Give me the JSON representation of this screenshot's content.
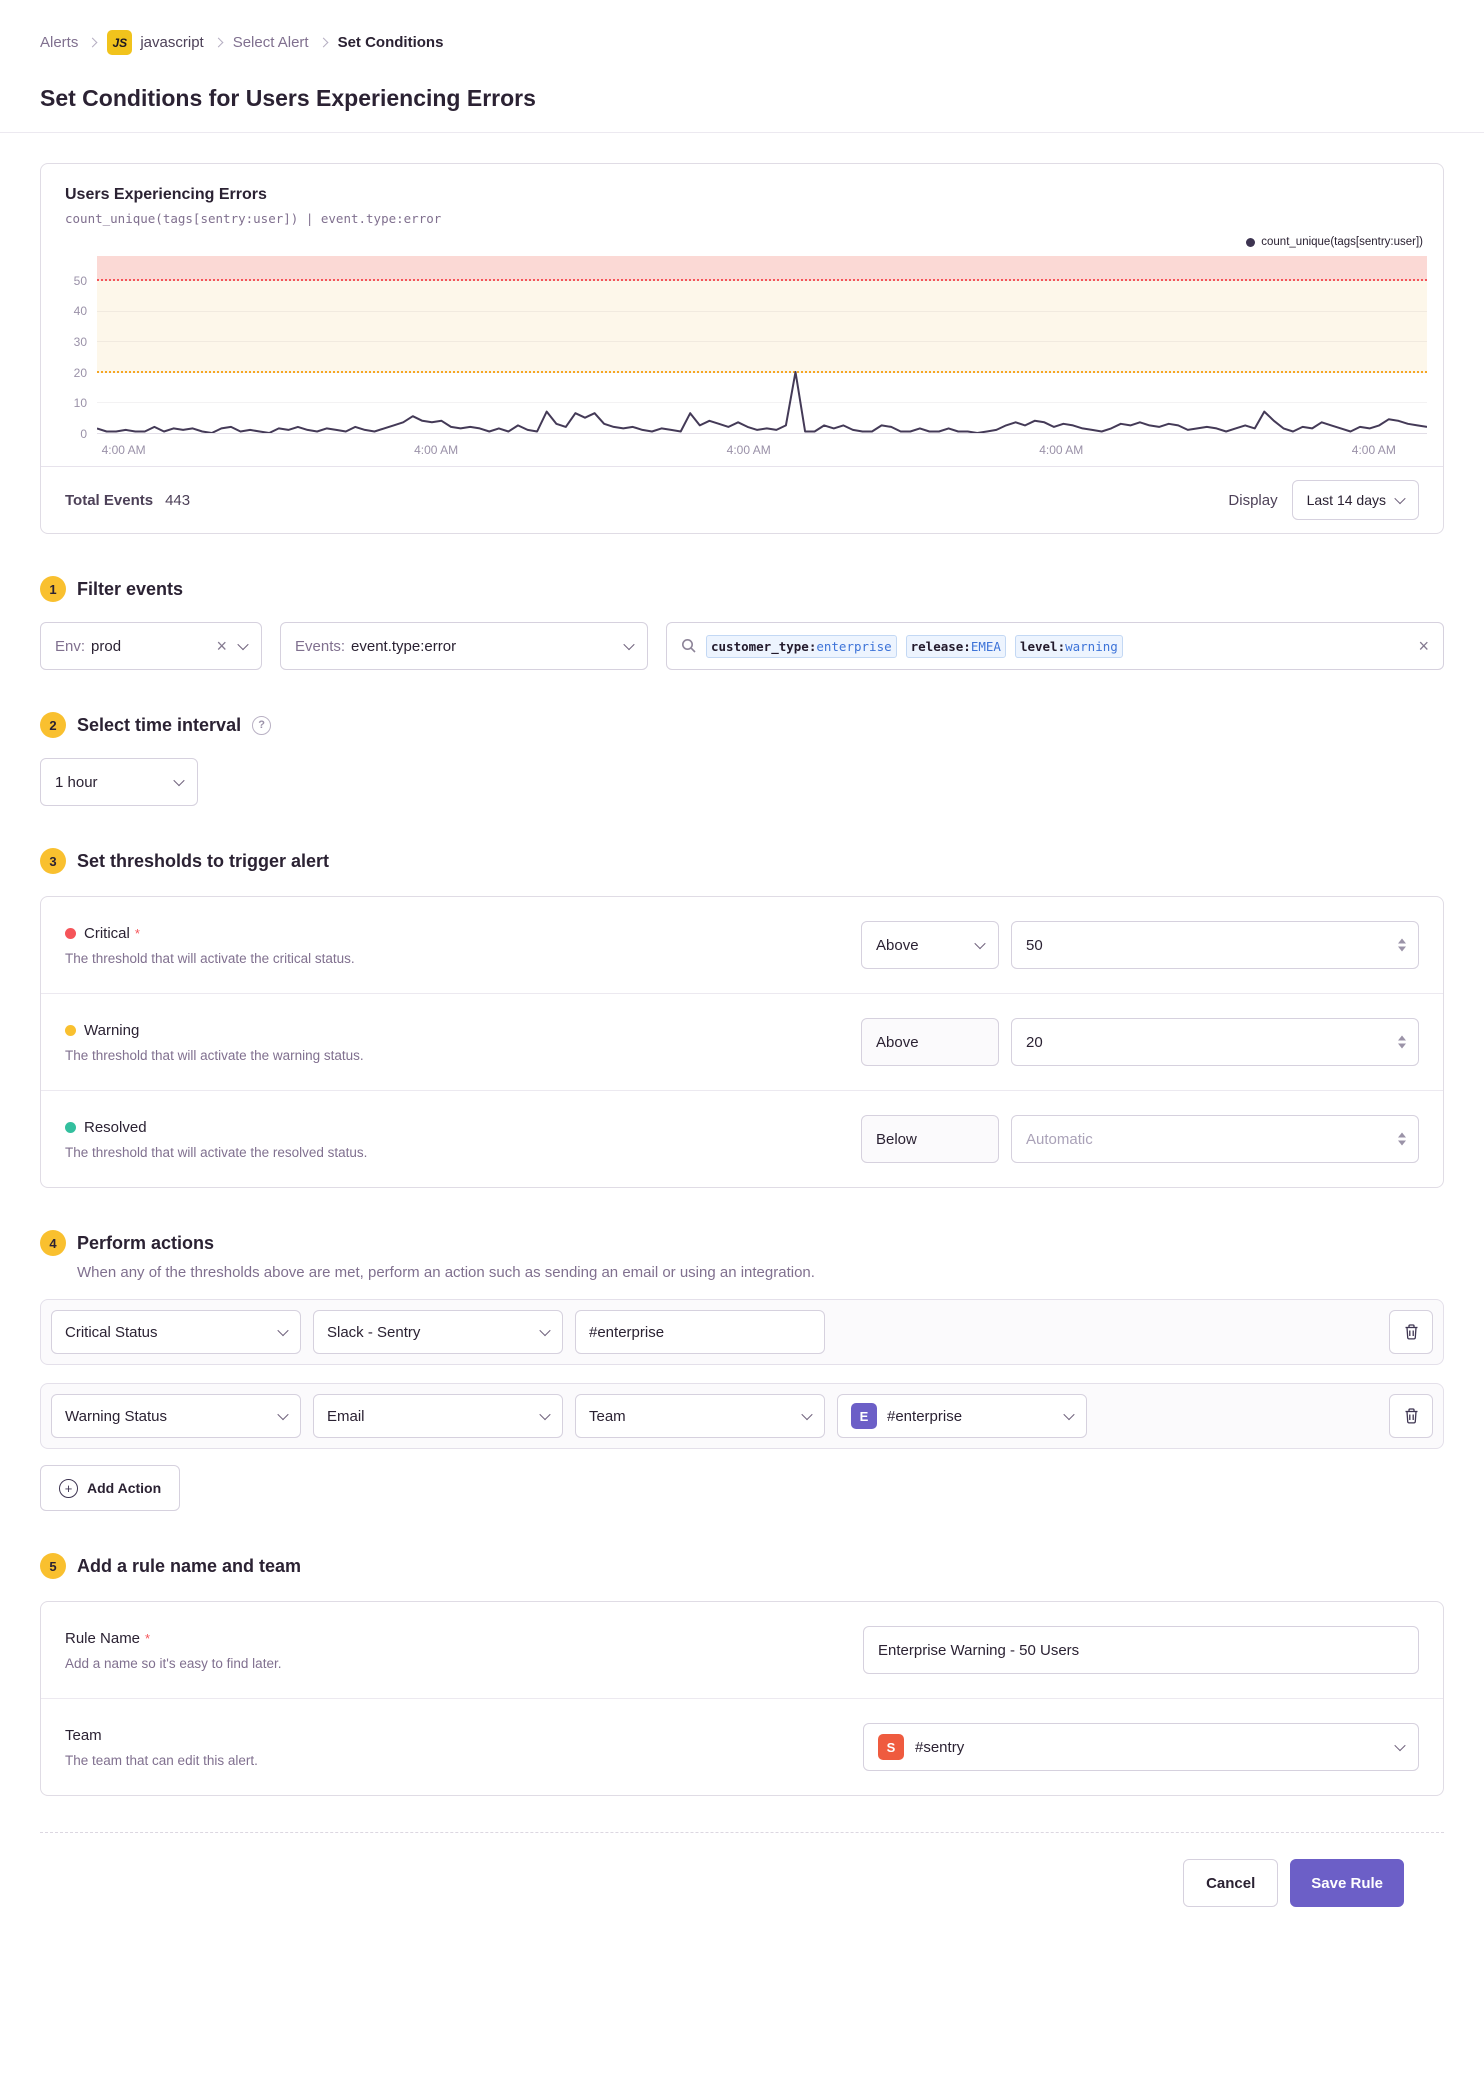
{
  "breadcrumb": {
    "items": [
      "Alerts",
      "javascript",
      "Select Alert",
      "Set Conditions"
    ],
    "project_badge": "JS"
  },
  "page": {
    "title": "Set Conditions for Users Experiencing Errors"
  },
  "icons": {
    "clear": "×",
    "plus": "+",
    "help": "?"
  },
  "misc": {
    "required_mark": "*"
  },
  "colors": {
    "accent": "#6c5fc7",
    "critical": "#f55459",
    "warning": "#f9c02f",
    "resolved": "#33bf9e",
    "badge": "#f9c02f",
    "token_value": "#3d73d8",
    "chart_line": "#443a57"
  },
  "chart_data": {
    "type": "line",
    "title": "Users Experiencing Errors",
    "query": "count_unique(tags[sentry:user]) | event.type:error",
    "legend": [
      "count_unique(tags[sentry:user])"
    ],
    "legend_position": "top-right",
    "grid": true,
    "x_tick_labels": [
      "4:00 AM",
      "4:00 AM",
      "4:00 AM",
      "4:00 AM",
      "4:00 AM"
    ],
    "y_ticks": [
      0,
      10,
      20,
      30,
      40,
      50
    ],
    "ylim": [
      0,
      58
    ],
    "thresholds": {
      "critical": 50,
      "warning": 20
    },
    "threshold_colors": {
      "critical": "#f55459",
      "warning": "#f5a623"
    },
    "band_colors": {
      "critical": "#fbd9d5",
      "warning": "#fdf7ea"
    },
    "line_color": "#443a57",
    "series": [
      {
        "name": "count_unique(tags[sentry:user])",
        "values": [
          1.5,
          0.5,
          0.5,
          1,
          0.5,
          0.5,
          2,
          0.5,
          1.5,
          1,
          1.5,
          0.5,
          0,
          1.5,
          2,
          0.5,
          1,
          0.5,
          0,
          1.5,
          1,
          2,
          1,
          0.5,
          1.5,
          1,
          0.5,
          2,
          1,
          0.5,
          1.5,
          2.5,
          3.5,
          5.5,
          4,
          3.5,
          4,
          2,
          1.5,
          2,
          1.5,
          0.5,
          1.5,
          0.5,
          2.5,
          1,
          0.5,
          7,
          3,
          2,
          6.5,
          5,
          6.5,
          3,
          2,
          1.5,
          2,
          1,
          0.5,
          1.5,
          1,
          0.5,
          6.5,
          2.5,
          4,
          3,
          2,
          3.5,
          2,
          1,
          1.5,
          1,
          2.5,
          20,
          0.5,
          0.5,
          2.5,
          1.5,
          2.5,
          1,
          0.5,
          0.5,
          2.5,
          2,
          0.5,
          0.5,
          1.5,
          0.5,
          0.5,
          1.5,
          0.5,
          0.5,
          0,
          0.5,
          1,
          2.5,
          3.5,
          2.5,
          4,
          3.5,
          2,
          3,
          2.5,
          1.5,
          1,
          0.5,
          1.5,
          3,
          2.5,
          3.5,
          2.5,
          2,
          3,
          2.5,
          1,
          1.5,
          2,
          1.5,
          0.5,
          1.5,
          2.5,
          1.5,
          7,
          4,
          1.5,
          0.5,
          2,
          1.5,
          3.5,
          2.5,
          1.5,
          0.5,
          2,
          1.5,
          2.5,
          4.5,
          4,
          3,
          2.5,
          2
        ]
      }
    ]
  },
  "chart_footer": {
    "total_events_label": "Total Events",
    "total_events_value": "443",
    "display_label": "Display",
    "range_value": "Last 14 days"
  },
  "sections": {
    "filter": {
      "num": "1",
      "heading": "Filter events",
      "env_label": "Env:",
      "env_value": "prod",
      "events_label": "Events:",
      "events_value": "event.type:error",
      "search_tokens": [
        {
          "key": "customer_type:",
          "value": "enterprise"
        },
        {
          "key": "release:",
          "value": "EMEA"
        },
        {
          "key": "level:",
          "value": "warning"
        }
      ]
    },
    "interval": {
      "num": "2",
      "heading": "Select time interval",
      "value": "1 hour"
    },
    "thresholds": {
      "num": "3",
      "heading": "Set thresholds to trigger alert",
      "rows": [
        {
          "label": "Critical",
          "description": "The threshold that will activate the critical status.",
          "comparison": "Above",
          "value": "50",
          "placeholder": ""
        },
        {
          "label": "Warning",
          "description": "The threshold that will activate the warning status.",
          "comparison": "Above",
          "value": "20",
          "placeholder": ""
        },
        {
          "label": "Resolved",
          "description": "The threshold that will activate the resolved status.",
          "comparison": "Below",
          "value": "",
          "placeholder": "Automatic"
        }
      ]
    },
    "actions": {
      "num": "4",
      "heading": "Perform actions",
      "description": "When any of the thresholds above are met, perform an action such as sending an email or using an integration.",
      "rows": [
        {
          "trigger": "Critical Status",
          "integration": "Slack - Sentry",
          "target": "#enterprise"
        },
        {
          "trigger": "Warning Status",
          "integration": "Email",
          "target_type": "Team",
          "team_avatar": "E",
          "team": "#enterprise"
        }
      ],
      "add_button": "Add Action"
    },
    "rule": {
      "num": "5",
      "heading": "Add a rule name and team",
      "name_label": "Rule Name",
      "name_description": "Add a name so it's easy to find later.",
      "name_value": "Enterprise Warning - 50 Users",
      "team_label": "Team",
      "team_description": "The team that can edit this alert.",
      "team_avatar": "S",
      "team_value": "#sentry"
    }
  },
  "footer": {
    "cancel": "Cancel",
    "save": "Save Rule"
  }
}
